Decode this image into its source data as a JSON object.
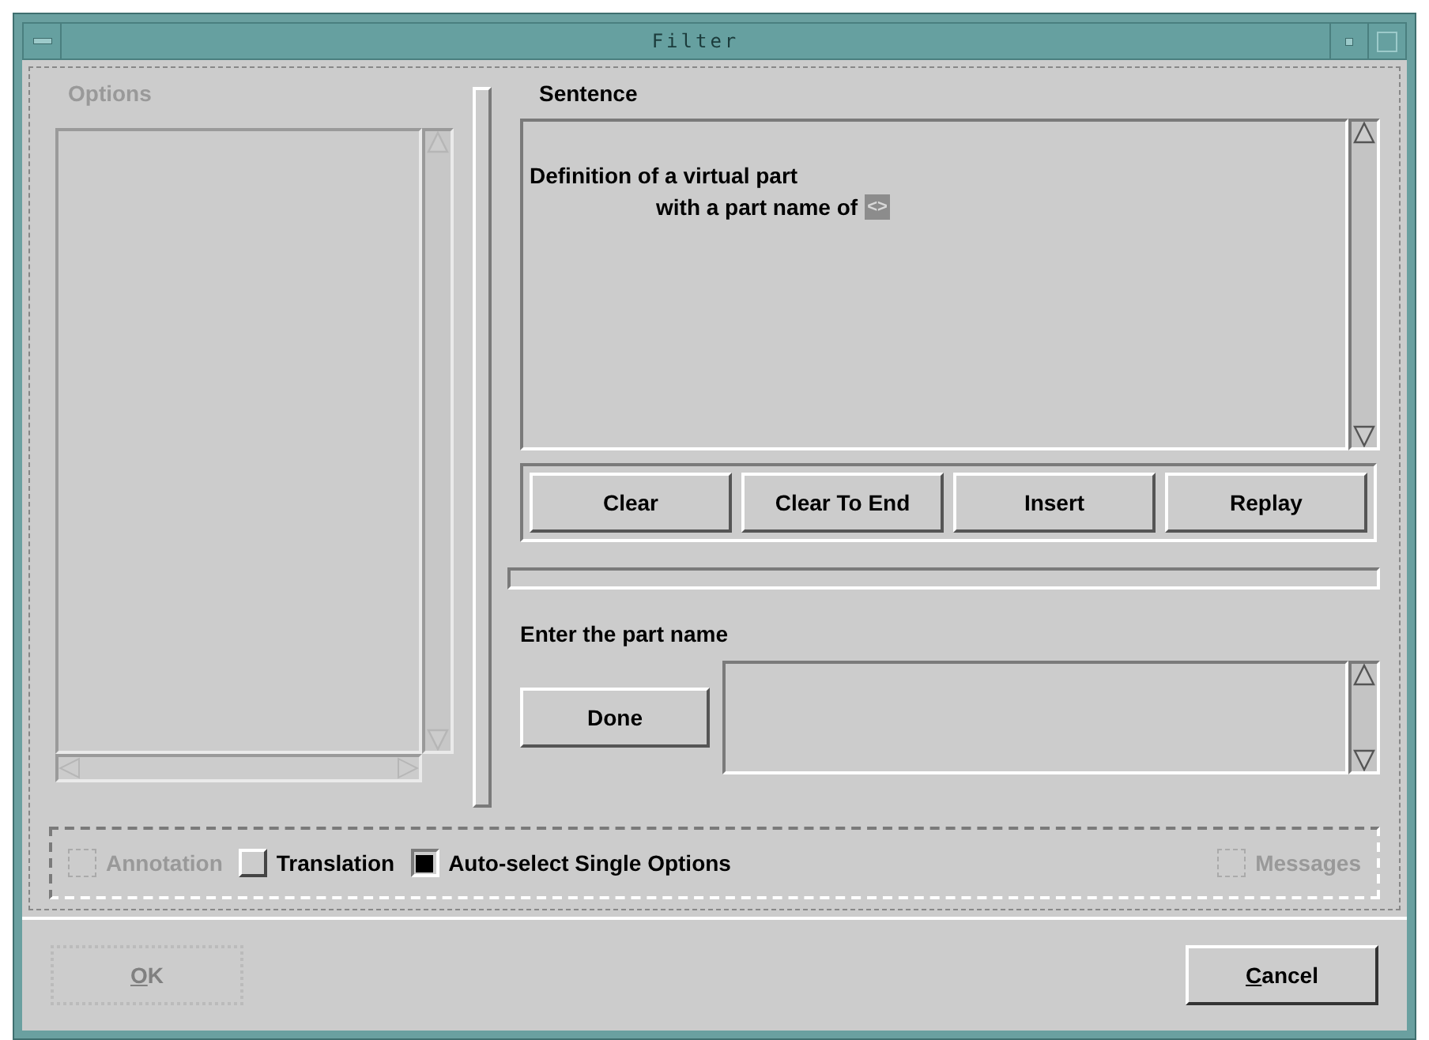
{
  "window": {
    "title": "Filter"
  },
  "options": {
    "label": "Options",
    "disabled": true
  },
  "sentence": {
    "label": "Sentence",
    "lines": [
      {
        "text": "Definition of a virtual part",
        "indented": false
      },
      {
        "text": "with a part name of",
        "indented": true,
        "slot": "<>"
      }
    ]
  },
  "sentence_buttons": [
    "Clear",
    "Clear To End",
    "Insert",
    "Replay"
  ],
  "prompt": {
    "label": "Enter the part name",
    "button": "Done"
  },
  "toggles": [
    {
      "label": "Annotation",
      "checked": false,
      "disabled": true
    },
    {
      "label": "Translation",
      "checked": false,
      "disabled": false
    },
    {
      "label": "Auto-select Single Options",
      "checked": true,
      "disabled": false
    },
    {
      "label": "Messages",
      "checked": false,
      "disabled": true
    }
  ],
  "buttons": [
    {
      "label": "OK",
      "disabled": true,
      "mnemonic": true
    },
    {
      "label": "Cancel",
      "disabled": false,
      "mnemonic": true
    }
  ]
}
